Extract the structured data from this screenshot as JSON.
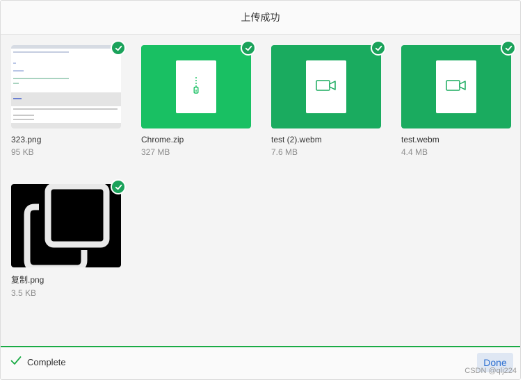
{
  "header": {
    "title": "上传成功"
  },
  "files": [
    {
      "name": "323.png",
      "size": "95 KB",
      "type": "image-screenshot"
    },
    {
      "name": "Chrome.zip",
      "size": "327 MB",
      "type": "zip",
      "color": "#19c063",
      "icon": "zip-file-icon"
    },
    {
      "name": "test (2).webm",
      "size": "7.6 MB",
      "type": "video",
      "color": "#1aab5f",
      "icon": "video-camera-icon"
    },
    {
      "name": "test.webm",
      "size": "4.4 MB",
      "type": "video",
      "color": "#1aab5f",
      "icon": "video-camera-icon"
    },
    {
      "name": "复制.png",
      "size": "3.5 KB",
      "type": "image-copy-icon"
    }
  ],
  "footer": {
    "status": "Complete",
    "done_label": "Done",
    "accent": "#1aab45"
  },
  "watermark": "CSDN @qlj224"
}
